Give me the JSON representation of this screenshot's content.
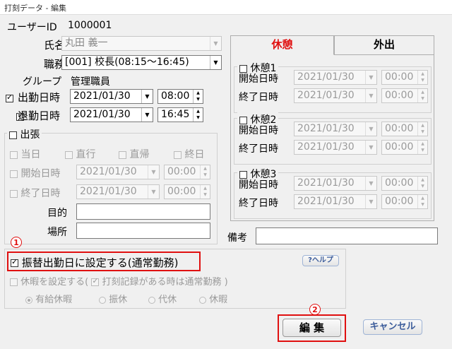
{
  "window": {
    "title": "打刻データ - 編集"
  },
  "employee": {
    "id_label": "ユーザーID",
    "id_value": "1000001",
    "name_label": "氏名",
    "name_value": "丸田 義一",
    "duty_label": "職務",
    "duty_value": "[001] 校長(08:15～16:45)",
    "group_label": "グループ",
    "group_value": "管理職員"
  },
  "attendance": {
    "in_label": "出勤日時",
    "in_date": "2021/01/30",
    "in_time": "08:00",
    "out_label": "退勤日時",
    "out_date": "2021/01/30",
    "out_time": "16:45"
  },
  "trip": {
    "group_label": "出張",
    "same_day": "当日",
    "direct_go": "直行",
    "direct_return": "直帰",
    "all_day": "終日",
    "start_label": "開始日時",
    "start_date": "2021/01/30",
    "start_time": "00:00",
    "end_label": "終了日時",
    "end_date": "2021/01/30",
    "end_time": "00:00",
    "purpose_label": "目的",
    "place_label": "場所"
  },
  "tabs": {
    "break": "休憩",
    "out": "外出"
  },
  "breaks": [
    {
      "label": "休憩1",
      "start_label": "開始日時",
      "start_date": "2021/01/30",
      "start_time": "00:00",
      "end_label": "終了日時",
      "end_date": "2021/01/30",
      "end_time": "00:00"
    },
    {
      "label": "休憩2",
      "start_label": "開始日時",
      "start_date": "2021/01/30",
      "start_time": "00:00",
      "end_label": "終了日時",
      "end_date": "2021/01/30",
      "end_time": "00:00"
    },
    {
      "label": "休憩3",
      "start_label": "開始日時",
      "start_date": "2021/01/30",
      "start_time": "00:00",
      "end_label": "終了日時",
      "end_date": "2021/01/30",
      "end_time": "00:00"
    }
  ],
  "remarks_label": "備考",
  "substitute": {
    "checkbox_label": "振替出勤日に設定する(通常勤務)",
    "help_label": "?ヘルプ",
    "leave_label": "休暇を設定する(",
    "leave_sub_label": "打刻記録がある時は通常勤務 )",
    "options": [
      "有給休暇",
      "振休",
      "代休",
      "休暇"
    ]
  },
  "buttons": {
    "edit": "編 集",
    "cancel": "キャンセル"
  },
  "callouts": {
    "one": "1",
    "two": "2"
  },
  "colors": {
    "tab_active_text": "#e01010",
    "callout_red": "#e01010"
  }
}
